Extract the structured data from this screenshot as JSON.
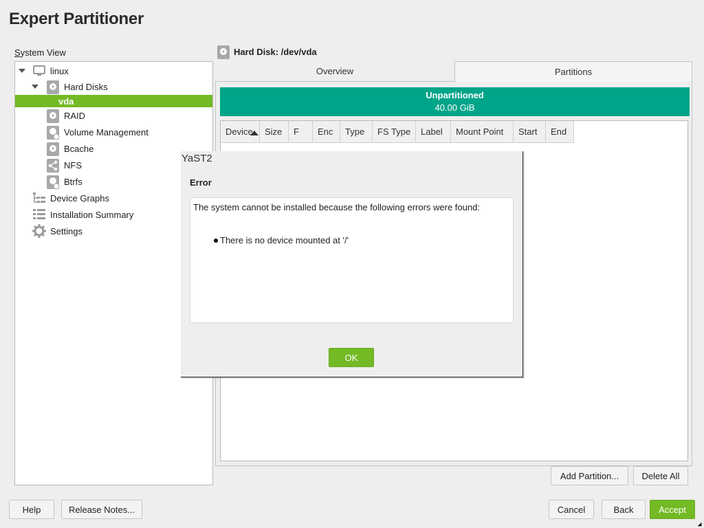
{
  "page": {
    "title": "Expert Partitioner"
  },
  "sidebar": {
    "label": "System View",
    "items": [
      {
        "label": "linux",
        "icon": "computer-icon"
      },
      {
        "label": "Hard Disks",
        "icon": "hard-disk-icon"
      },
      {
        "label": "vda",
        "icon": ""
      },
      {
        "label": "RAID",
        "icon": "raid-icon"
      },
      {
        "label": "Volume Management",
        "icon": "volume-management-icon"
      },
      {
        "label": "Bcache",
        "icon": "bcache-icon"
      },
      {
        "label": "NFS",
        "icon": "nfs-share-icon"
      },
      {
        "label": "Btrfs",
        "icon": "btrfs-icon"
      },
      {
        "label": "Device Graphs",
        "icon": "device-graphs-icon"
      },
      {
        "label": "Installation Summary",
        "icon": "list-icon"
      },
      {
        "label": "Settings",
        "icon": "gear-icon"
      }
    ]
  },
  "main": {
    "header": "Hard Disk: /dev/vda",
    "tabs": [
      {
        "label": "Overview",
        "mnemonic": "O"
      },
      {
        "label": "Partitions",
        "mnemonic": "P"
      }
    ],
    "unpartitioned": {
      "label": "Unpartitioned",
      "size": "40.00 GiB",
      "color": "#00a489"
    },
    "table": {
      "columns": [
        "Device",
        "Size",
        "F",
        "Enc",
        "Type",
        "FS Type",
        "Label",
        "Mount Point",
        "Start",
        "End"
      ],
      "rows": []
    },
    "buttons": {
      "add_partition": "Add Partition...",
      "delete_all": "Delete All"
    }
  },
  "footer": {
    "help": "Help",
    "release_notes": "Release Notes...",
    "cancel": "Cancel",
    "back": "Back",
    "accept": "Accept"
  },
  "dialog": {
    "title": "YaST2",
    "heading": "Error",
    "message": "The system cannot be installed because the following errors were found:",
    "errors": [
      "There is no device mounted at '/'"
    ],
    "ok": "OK"
  },
  "colors": {
    "accent": "#73ba25",
    "teal": "#00a489"
  }
}
